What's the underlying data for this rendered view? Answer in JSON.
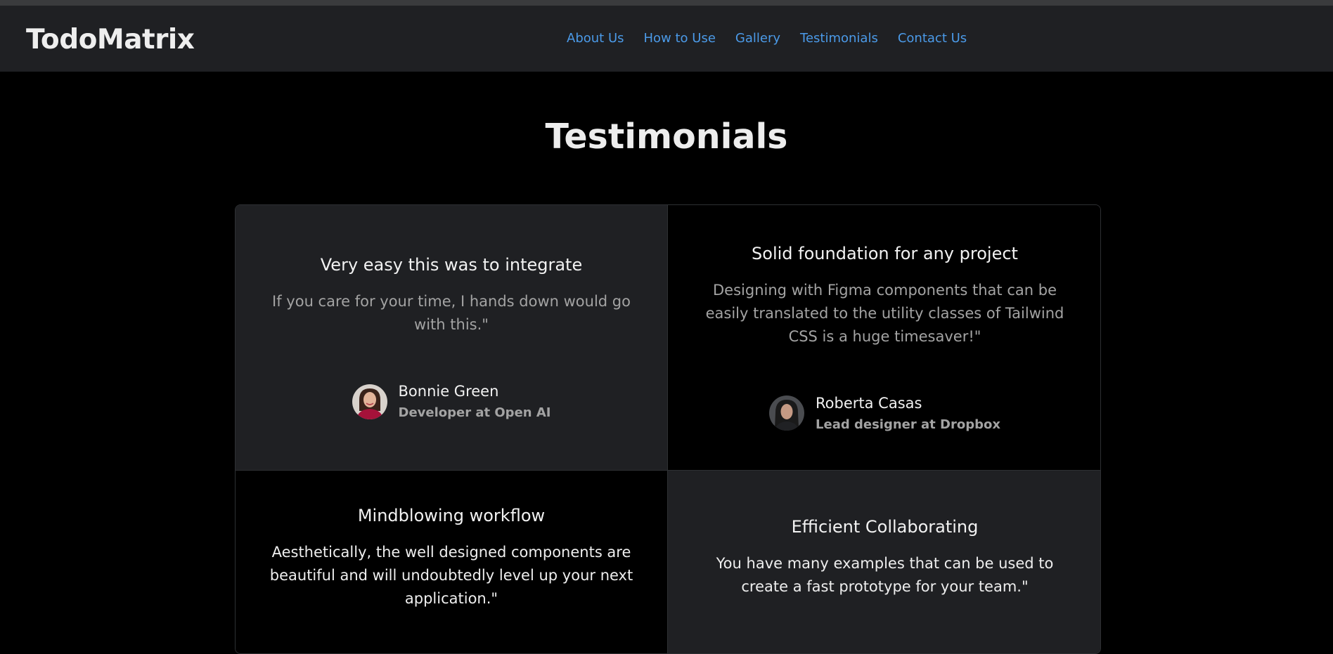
{
  "app": {
    "brand": "TodoMatrix"
  },
  "nav": {
    "links": [
      {
        "label": "About Us"
      },
      {
        "label": "How to Use"
      },
      {
        "label": "Gallery"
      },
      {
        "label": "Testimonials"
      },
      {
        "label": "Contact Us"
      }
    ]
  },
  "section": {
    "title": "Testimonials"
  },
  "testimonials": [
    {
      "title": "Very easy this was to integrate",
      "quote": "If you care for your time, I hands down would go with this.\"",
      "author_name": "Bonnie Green",
      "author_role": "Developer at Open AI",
      "avatar_icon": "avatar-woman-red-top"
    },
    {
      "title": "Solid foundation for any project",
      "quote": "Designing with Figma components that can be easily translated to the utility classes of Tailwind CSS is a huge timesaver!\"",
      "author_name": "Roberta Casas",
      "author_role": "Lead designer at Dropbox",
      "avatar_icon": "avatar-woman-dark"
    },
    {
      "title": "Mindblowing workflow",
      "quote": "Aesthetically, the well designed components are beautiful and will undoubtedly level up your next application.\""
    },
    {
      "title": "Efficient Collaborating",
      "quote": "You have many examples that can be used to create a fast prototype for your team.\""
    }
  ],
  "colors": {
    "background": "#000000",
    "navbar": "#1f2023",
    "link": "#4b9ae8",
    "card_alt": "#1f2023",
    "muted_text": "#a3a3a3"
  }
}
